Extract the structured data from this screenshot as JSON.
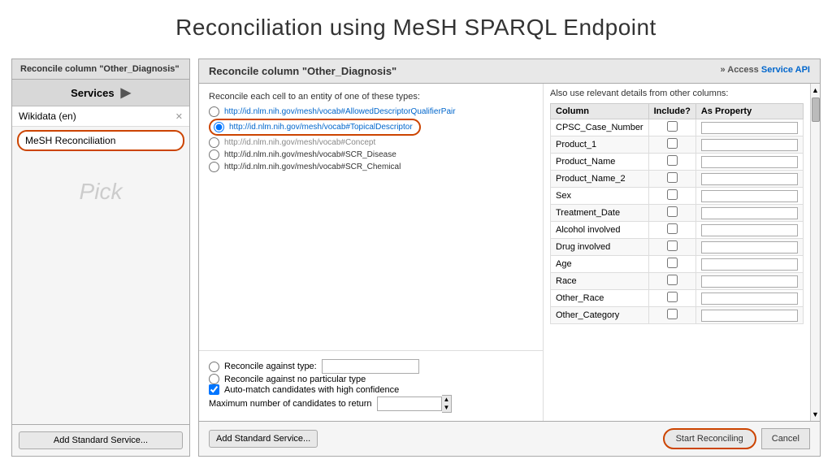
{
  "page": {
    "title": "Reconciliation using MeSH SPARQL Endpoint"
  },
  "left_panel": {
    "title": "Reconcile column \"Other_Diagnosis\"",
    "services_label": "Services",
    "services": [
      {
        "label": "Wikidata (en)",
        "removable": true
      },
      {
        "label": "MeSH Reconciliation",
        "highlighted": true
      }
    ],
    "pick_label": "Pick",
    "add_button_label": "Add Standard Service..."
  },
  "dialog": {
    "title": "Reconcile column \"Other_Diagnosis\"",
    "service_api_prefix": "» Access",
    "service_api_label": "Service API",
    "section_types_label": "Reconcile each cell to an entity of one of these types:",
    "types": [
      {
        "url": "http://id.nlm.nih.gov/mesh/vocab#AllowedDescriptorQualifierPair",
        "selected": false
      },
      {
        "url": "http://id.nlm.nih.gov/mesh/vocab#TopicalDescriptor",
        "selected": true,
        "highlighted": true
      },
      {
        "url": "http://id.nlm.nih.gov/mesh/vocab#Concept",
        "selected": false
      },
      {
        "url": "http://id.nlm.nih.gov/mesh/vocab#SCR_Disease",
        "selected": false
      },
      {
        "url": "http://id.nlm.nih.gov/mesh/vocab#SCR_Chemical",
        "selected": false
      }
    ],
    "reconcile_against_type_label": "Reconcile against type:",
    "reconcile_no_type_label": "Reconcile against no particular type",
    "auto_match_label": "Auto-match candidates with high confidence",
    "auto_match_checked": true,
    "max_candidates_label": "Maximum number of candidates to return",
    "columns_section_label": "Also use relevant details from other columns:",
    "columns_table": {
      "headers": [
        "Column",
        "Include?",
        "As Property"
      ],
      "rows": [
        {
          "column": "CPSC_Case_Number",
          "include": false,
          "property": ""
        },
        {
          "column": "Product_1",
          "include": false,
          "property": ""
        },
        {
          "column": "Product_Name",
          "include": false,
          "property": ""
        },
        {
          "column": "Product_Name_2",
          "include": false,
          "property": ""
        },
        {
          "column": "Sex",
          "include": false,
          "property": ""
        },
        {
          "column": "Treatment_Date",
          "include": false,
          "property": ""
        },
        {
          "column": "Alcohol involved",
          "include": false,
          "property": ""
        },
        {
          "column": "Drug involved",
          "include": false,
          "property": ""
        },
        {
          "column": "Age",
          "include": false,
          "property": ""
        },
        {
          "column": "Race",
          "include": false,
          "property": ""
        },
        {
          "column": "Other_Race",
          "include": false,
          "property": ""
        },
        {
          "column": "Other_Category",
          "include": false,
          "property": ""
        }
      ]
    },
    "footer": {
      "add_button_label": "Add Standard Service...",
      "start_label": "Start Reconciling",
      "cancel_label": "Cancel"
    }
  }
}
